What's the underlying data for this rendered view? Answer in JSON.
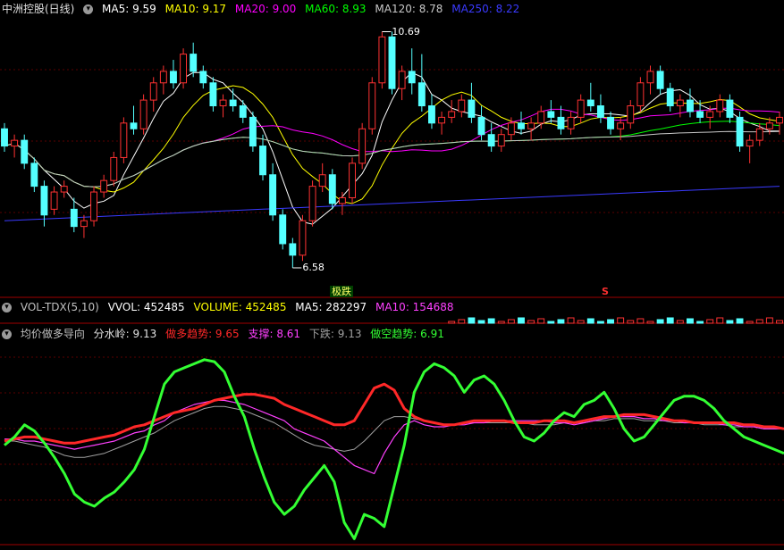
{
  "main_header": {
    "title": "中洲控股(日线)",
    "ma5": "MA5: 9.59",
    "ma10": "MA10: 9.17",
    "ma20": "MA20: 9.00",
    "ma60": "MA60: 8.93",
    "ma120": "MA120: 8.78",
    "ma250": "MA250: 8.22"
  },
  "vol_header": {
    "name": "VOL-TDX(5,10)",
    "vvol": "VVOL: 452485",
    "volume": "VOLUME: 452485",
    "ma5": "MA5: 282297",
    "ma10": "MA10: 154688"
  },
  "ind_header": {
    "name": "均价做多导向",
    "fsl": "分水岭: 9.13",
    "long": "做多趋势: 9.65",
    "support": "支撑: 8.61",
    "down": "下跌: 9.13",
    "short": "做空趋势: 6.91"
  },
  "annotations": {
    "high": "10.69",
    "low": "6.58",
    "signal": "极跌",
    "s_marker": "S"
  },
  "colors": {
    "up": "#ff3232",
    "down": "#54ffff",
    "ma5": "#ffffff",
    "ma10": "#ffff00",
    "ma20": "#ff00ff",
    "ma60": "#00ff00",
    "ma120": "#c8c8c8",
    "ma250": "#3a3aff",
    "long": "#ff2828",
    "support": "#ff40ff",
    "down_line": "#a0a0a0",
    "short": "#33ff33"
  },
  "chart_data": [
    {
      "type": "candlestick",
      "price_range": [
        6.58,
        10.69
      ],
      "ohlc": [
        [
          9.0,
          9.1,
          8.6,
          8.7
        ],
        [
          8.7,
          8.9,
          8.5,
          8.8
        ],
        [
          8.8,
          8.9,
          8.3,
          8.4
        ],
        [
          8.4,
          8.5,
          7.9,
          8.0
        ],
        [
          8.0,
          8.1,
          7.3,
          7.5
        ],
        [
          7.6,
          8.0,
          7.5,
          7.9
        ],
        [
          7.9,
          8.1,
          7.8,
          8.0
        ],
        [
          7.6,
          7.8,
          7.2,
          7.3
        ],
        [
          7.3,
          7.5,
          7.1,
          7.4
        ],
        [
          7.4,
          8.0,
          7.3,
          7.9
        ],
        [
          7.9,
          8.2,
          7.8,
          8.1
        ],
        [
          8.1,
          8.6,
          8.0,
          8.5
        ],
        [
          8.5,
          9.2,
          8.4,
          9.1
        ],
        [
          9.1,
          9.4,
          8.9,
          9.0
        ],
        [
          9.0,
          9.6,
          8.9,
          9.5
        ],
        [
          9.5,
          9.9,
          9.3,
          9.8
        ],
        [
          9.8,
          10.1,
          9.6,
          10.0
        ],
        [
          10.0,
          10.2,
          9.7,
          9.8
        ],
        [
          9.8,
          10.4,
          9.7,
          10.3
        ],
        [
          10.3,
          10.5,
          9.9,
          10.0
        ],
        [
          10.0,
          10.1,
          9.7,
          9.8
        ],
        [
          9.8,
          9.9,
          9.3,
          9.4
        ],
        [
          9.4,
          9.6,
          9.2,
          9.5
        ],
        [
          9.5,
          9.7,
          9.3,
          9.4
        ],
        [
          9.4,
          9.5,
          9.1,
          9.2
        ],
        [
          9.2,
          9.3,
          8.6,
          8.7
        ],
        [
          8.7,
          8.9,
          8.1,
          8.2
        ],
        [
          8.2,
          8.4,
          7.4,
          7.5
        ],
        [
          7.5,
          7.6,
          6.9,
          7.0
        ],
        [
          7.0,
          7.1,
          6.58,
          6.8
        ],
        [
          6.8,
          7.5,
          6.7,
          7.4
        ],
        [
          7.4,
          8.1,
          7.3,
          8.0
        ],
        [
          8.0,
          8.4,
          7.9,
          8.2
        ],
        [
          8.2,
          8.3,
          7.6,
          7.7
        ],
        [
          7.7,
          7.9,
          7.5,
          7.8
        ],
        [
          7.8,
          8.5,
          7.7,
          8.4
        ],
        [
          8.4,
          9.1,
          8.3,
          9.0
        ],
        [
          9.0,
          9.9,
          8.9,
          9.8
        ],
        [
          9.8,
          10.69,
          9.7,
          10.6
        ],
        [
          10.6,
          10.69,
          9.6,
          9.7
        ],
        [
          9.7,
          10.1,
          9.5,
          10.0
        ],
        [
          10.0,
          10.4,
          9.6,
          9.8
        ],
        [
          9.8,
          10.3,
          9.3,
          9.4
        ],
        [
          9.4,
          9.6,
          9.0,
          9.1
        ],
        [
          9.1,
          9.3,
          8.9,
          9.2
        ],
        [
          9.2,
          9.5,
          9.1,
          9.3
        ],
        [
          9.3,
          9.6,
          9.2,
          9.5
        ],
        [
          9.5,
          9.8,
          9.1,
          9.2
        ],
        [
          9.2,
          9.4,
          8.8,
          8.9
        ],
        [
          8.9,
          9.1,
          8.6,
          8.7
        ],
        [
          8.7,
          9.0,
          8.6,
          8.9
        ],
        [
          8.9,
          9.2,
          8.8,
          9.1
        ],
        [
          9.1,
          9.3,
          8.9,
          9.0
        ],
        [
          9.0,
          9.2,
          8.8,
          9.1
        ],
        [
          9.1,
          9.4,
          9.0,
          9.3
        ],
        [
          9.3,
          9.5,
          9.1,
          9.2
        ],
        [
          9.2,
          9.4,
          8.9,
          9.0
        ],
        [
          9.0,
          9.3,
          8.9,
          9.2
        ],
        [
          9.2,
          9.6,
          9.1,
          9.5
        ],
        [
          9.5,
          9.8,
          9.3,
          9.4
        ],
        [
          9.4,
          9.6,
          9.1,
          9.2
        ],
        [
          9.2,
          9.3,
          8.9,
          9.0
        ],
        [
          9.0,
          9.2,
          8.8,
          9.1
        ],
        [
          9.1,
          9.5,
          9.0,
          9.4
        ],
        [
          9.4,
          9.9,
          9.3,
          9.8
        ],
        [
          9.8,
          10.1,
          9.6,
          10.0
        ],
        [
          10.0,
          10.1,
          9.6,
          9.7
        ],
        [
          9.7,
          9.8,
          9.3,
          9.4
        ],
        [
          9.4,
          9.6,
          9.2,
          9.5
        ],
        [
          9.5,
          9.7,
          9.2,
          9.3
        ],
        [
          9.3,
          9.5,
          9.1,
          9.2
        ],
        [
          9.2,
          9.4,
          9.0,
          9.3
        ],
        [
          9.3,
          9.6,
          9.2,
          9.5
        ],
        [
          9.5,
          9.6,
          9.1,
          9.2
        ],
        [
          9.2,
          9.3,
          8.6,
          8.7
        ],
        [
          8.7,
          8.9,
          8.4,
          8.8
        ],
        [
          8.8,
          9.1,
          8.7,
          9.0
        ],
        [
          9.0,
          9.2,
          8.9,
          9.1
        ],
        [
          9.1,
          9.3,
          8.9,
          9.2
        ]
      ]
    },
    {
      "type": "line",
      "series_names": [
        "做多趋势",
        "支撑",
        "下跌",
        "做空趋势"
      ],
      "long": [
        50,
        51,
        52,
        52,
        51,
        50,
        49,
        49,
        50,
        51,
        52,
        53,
        55,
        57,
        58,
        60,
        62,
        64,
        65,
        66,
        68,
        70,
        71,
        72,
        73,
        73,
        72,
        71,
        68,
        66,
        64,
        62,
        60,
        58,
        58,
        60,
        68,
        76,
        78,
        75,
        66,
        62,
        60,
        59,
        58,
        58,
        59,
        60,
        60,
        60,
        60,
        59,
        59,
        59,
        60,
        60,
        60,
        59,
        60,
        61,
        62,
        62,
        63,
        63,
        63,
        62,
        61,
        60,
        60,
        59,
        59,
        59,
        59,
        59,
        58,
        58,
        57,
        57,
        56
      ],
      "support": [
        51,
        51,
        50,
        50,
        49,
        48,
        47,
        46,
        47,
        48,
        49,
        50,
        52,
        54,
        55,
        58,
        60,
        64,
        66,
        68,
        69,
        70,
        70,
        69,
        68,
        66,
        64,
        62,
        60,
        56,
        54,
        52,
        50,
        46,
        42,
        38,
        36,
        34,
        44,
        52,
        58,
        60,
        58,
        57,
        57,
        58,
        58,
        59,
        59,
        60,
        60,
        60,
        60,
        60,
        60,
        59,
        59,
        58,
        59,
        60,
        61,
        62,
        62,
        62,
        61,
        61,
        60,
        60,
        59,
        59,
        59,
        59,
        58,
        58,
        57,
        57,
        56,
        56,
        56
      ],
      "down": [
        50,
        50,
        49,
        48,
        47,
        45,
        43,
        42,
        42,
        43,
        44,
        46,
        48,
        50,
        52,
        54,
        57,
        60,
        62,
        64,
        66,
        67,
        67,
        66,
        65,
        63,
        61,
        59,
        56,
        53,
        50,
        48,
        47,
        46,
        45,
        46,
        50,
        55,
        60,
        62,
        62,
        61,
        60,
        59,
        58,
        58,
        59,
        59,
        59,
        59,
        59,
        59,
        59,
        58,
        58,
        58,
        59,
        59,
        59,
        60,
        60,
        61,
        61,
        61,
        60,
        60,
        60,
        59,
        59,
        59,
        58,
        58,
        58,
        57,
        57,
        57,
        56,
        56,
        56
      ],
      "short": [
        48,
        52,
        58,
        55,
        49,
        42,
        34,
        24,
        20,
        18,
        22,
        25,
        30,
        36,
        46,
        62,
        78,
        84,
        86,
        88,
        90,
        89,
        84,
        72,
        62,
        46,
        32,
        20,
        14,
        18,
        26,
        32,
        38,
        30,
        10,
        2,
        14,
        12,
        8,
        28,
        48,
        74,
        84,
        88,
        86,
        82,
        74,
        80,
        82,
        78,
        70,
        60,
        52,
        50,
        54,
        60,
        64,
        62,
        68,
        70,
        74,
        66,
        56,
        50,
        52,
        58,
        64,
        70,
        72,
        72,
        70,
        66,
        60,
        56,
        52,
        50,
        48,
        46,
        44
      ]
    }
  ]
}
